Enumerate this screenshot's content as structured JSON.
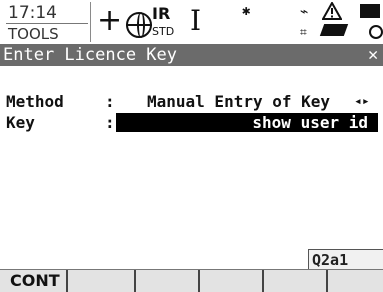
{
  "status": {
    "time": "17:14",
    "program": "TOOLS",
    "position_mode": "IR",
    "position_sub": "STD",
    "icons": [
      "crosshair-icon",
      "globe-icon",
      "ibeam-icon",
      "bluetooth-icon",
      "satellite-icon",
      "warning-icon",
      "memory-card-icon",
      "battery-icon",
      "disk-icon"
    ]
  },
  "title": "Enter Licence Key",
  "form": {
    "method_label": "Method",
    "method_value": "Manual Entry of Key",
    "key_label": "Key",
    "key_value": "show user id",
    "separator": ":"
  },
  "indicator": "Q2a1",
  "fkeys": [
    "CONT",
    "",
    "",
    "",
    "",
    ""
  ]
}
